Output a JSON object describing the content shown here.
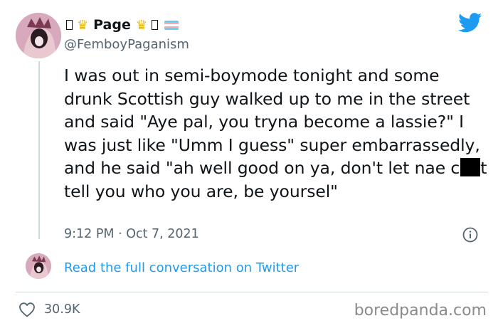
{
  "author": {
    "display_name": "Page",
    "handle": "@FemboyPaganism"
  },
  "tweet": {
    "text_before_redaction": "I was out in semi-boymode tonight and some drunk Scottish guy walked up to me in the street and said \"Aye pal, you tryna become a lassie?\" I was just like \"Umm I guess\" super embarrassedly, and he said \"ah well good on ya, don't let nae c",
    "text_after_redaction": "t tell you who you are, be yoursel\"",
    "timestamp": "9:12 PM · Oct 7, 2021"
  },
  "read_more_link": "Read the full conversation on Twitter",
  "likes_count": "30.9K",
  "watermark": "boredpanda.com",
  "colors": {
    "link_blue": "#1d9bf0",
    "secondary_text": "#536471",
    "divider": "#cfd9de",
    "crown": "#e6b800"
  },
  "icons": {
    "brand": "twitter-bird-icon",
    "info": "info-circle-icon",
    "like": "heart-icon",
    "crown": "crown-icon"
  }
}
